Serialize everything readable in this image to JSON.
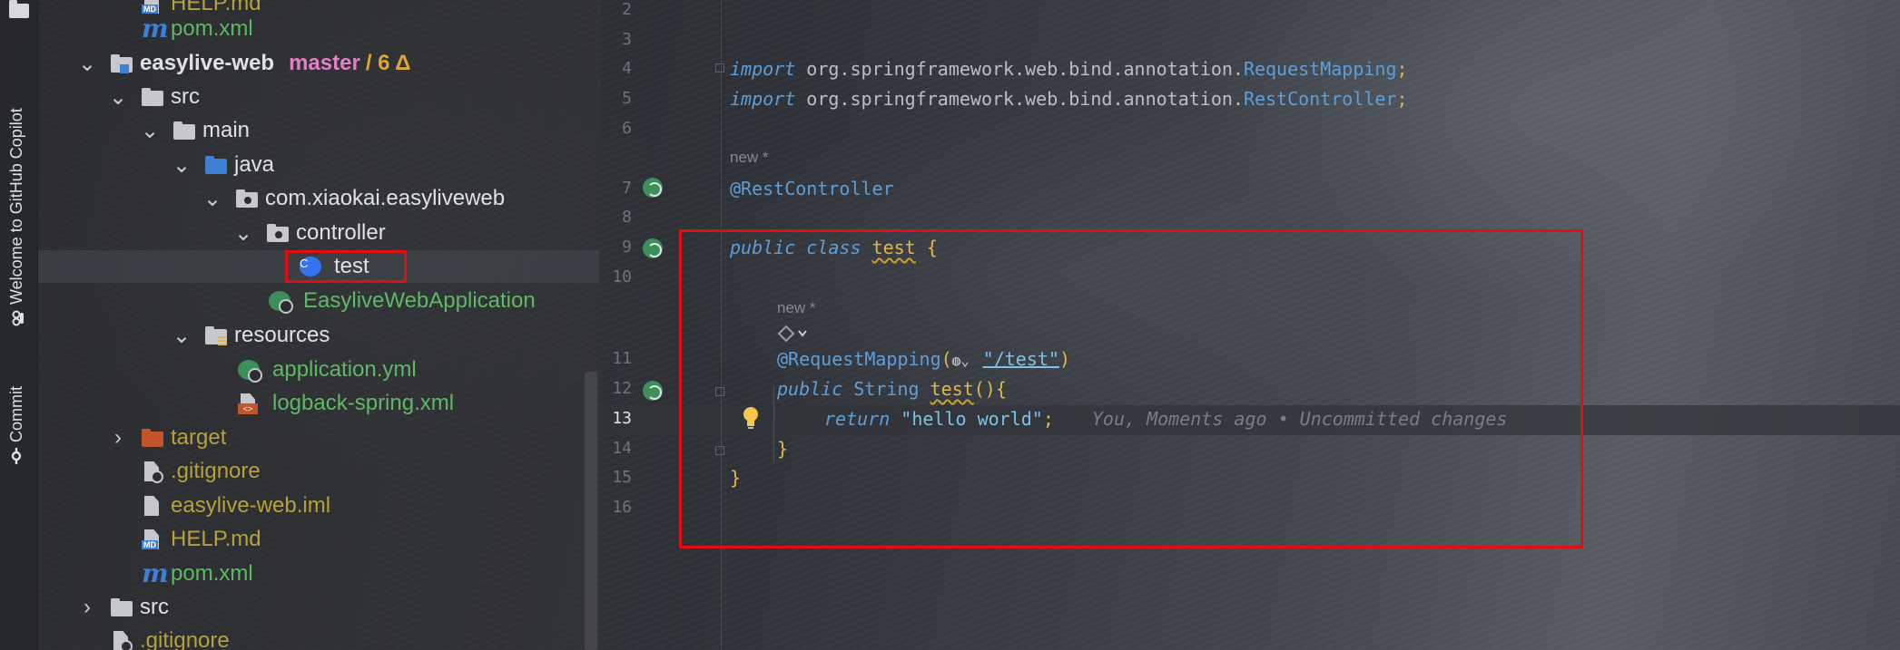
{
  "tool_window": {
    "copilot_tab": "Welcome to GitHub Copilot",
    "commit_tab": "Commit"
  },
  "project_tree": {
    "rows": [
      {
        "label": "HELP.md",
        "color": "olive"
      },
      {
        "label": "pom.xml",
        "color": "green"
      },
      {
        "label": "easylive-web",
        "branch": "master",
        "changes": "/ 6 Δ",
        "expanded": true
      },
      {
        "label": "src",
        "expanded": true
      },
      {
        "label": "main",
        "expanded": true
      },
      {
        "label": "java",
        "expanded": true
      },
      {
        "label": "com.xiaokai.easyliveweb",
        "expanded": true
      },
      {
        "label": "controller",
        "expanded": true
      },
      {
        "label": "test",
        "selected": true
      },
      {
        "label": "EasyliveWebApplication"
      },
      {
        "label": "resources",
        "expanded": true
      },
      {
        "label": "application.yml"
      },
      {
        "label": "logback-spring.xml"
      },
      {
        "label": "target",
        "expanded": false
      },
      {
        "label": ".gitignore"
      },
      {
        "label": "easylive-web.iml"
      },
      {
        "label": "HELP.md"
      },
      {
        "label": "pom.xml"
      },
      {
        "label": "src",
        "expanded": false
      },
      {
        "label": ".gitignore"
      }
    ]
  },
  "editor": {
    "line_numbers": [
      "2",
      "3",
      "4",
      "5",
      "6",
      "7",
      "8",
      "9",
      "10",
      "11",
      "12",
      "13",
      "14",
      "15",
      "16"
    ],
    "current_line": "13",
    "hint_new": "new *",
    "import1": {
      "kw": "import",
      "pkg": "org.springframework.web.bind.annotation.",
      "cls": "RequestMapping",
      "end": ";"
    },
    "import2": {
      "kw": "import",
      "pkg": "org.springframework.web.bind.annotation.",
      "cls": "RestController",
      "end": ";"
    },
    "rest_controller": "@RestController",
    "class_decl": {
      "public": "public",
      "class": "class",
      "name": "test",
      "brace": "{"
    },
    "request_mapping": {
      "ann": "@RequestMapping",
      "open": "(",
      "path": "\"/test\"",
      "close": ")"
    },
    "method_decl": {
      "public": "public",
      "type": "String",
      "name": "test",
      "parens": "()",
      "brace": "{"
    },
    "return_stmt": {
      "kw": "return",
      "str": "\"hello world\"",
      "end": ";"
    },
    "blame": "You, Moments ago • Uncommitted changes",
    "close_method": "}",
    "close_class": "}"
  }
}
